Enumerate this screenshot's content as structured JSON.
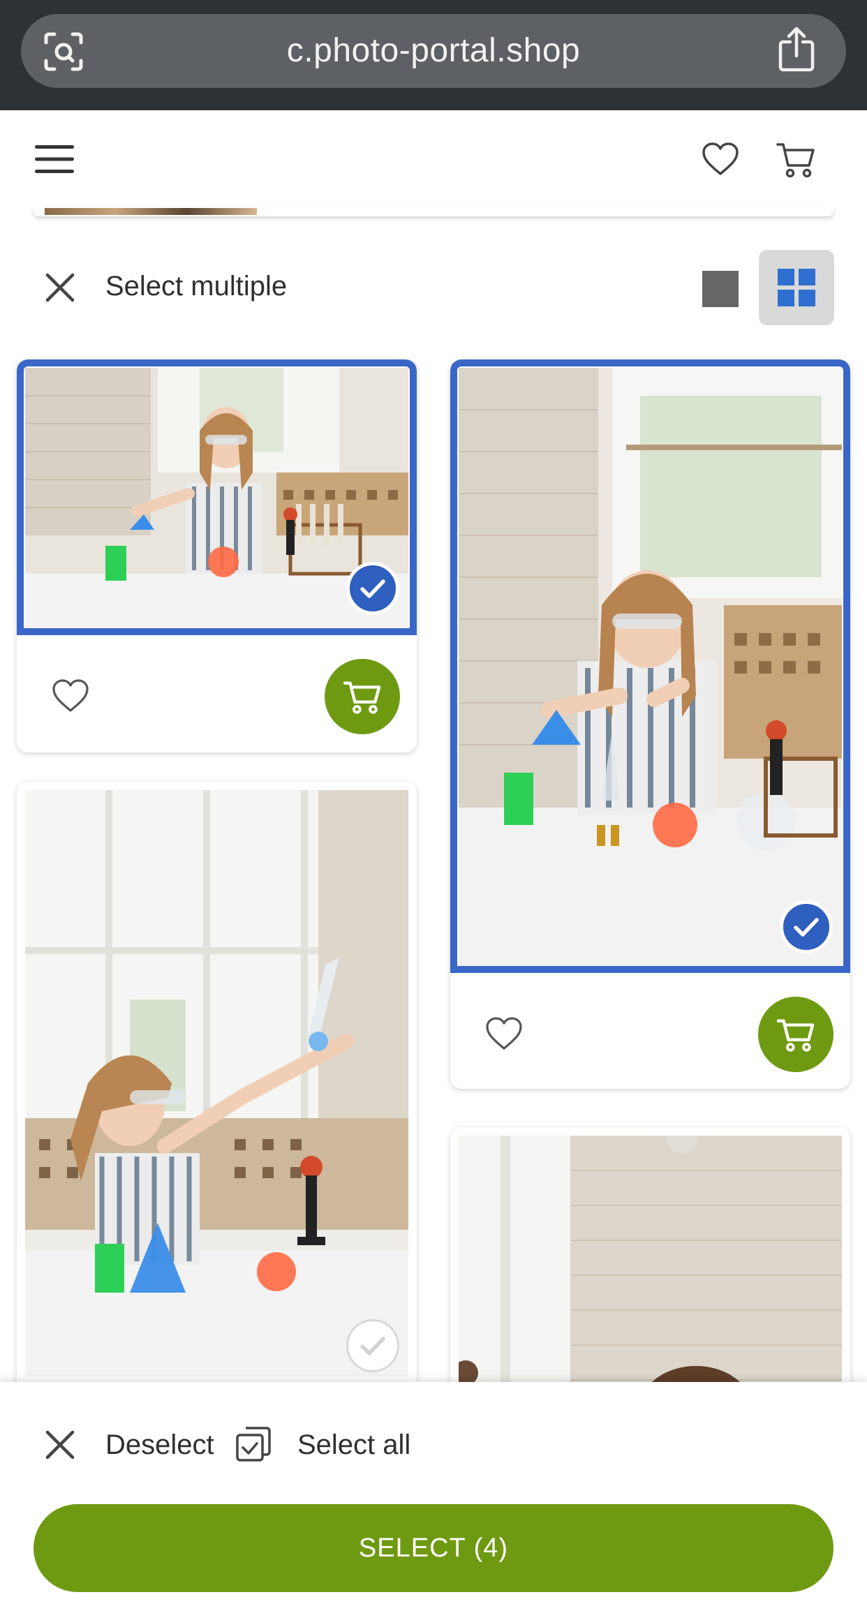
{
  "browser": {
    "url": "c.photo-portal.shop",
    "icons": {
      "left": "lens-icon",
      "right": "share-icon"
    }
  },
  "header": {
    "icons": [
      "menu-icon",
      "heart-icon",
      "cart-icon"
    ]
  },
  "selection_bar": {
    "title": "Select multiple",
    "close_icon": "close-icon",
    "view_modes": [
      "single-view-icon",
      "grid-view-icon"
    ],
    "active_view": "grid"
  },
  "photos": [
    {
      "id": "photo-1",
      "selected": true
    },
    {
      "id": "photo-2",
      "selected": true
    },
    {
      "id": "photo-3",
      "selected": false
    },
    {
      "id": "photo-4",
      "selected": false
    }
  ],
  "bottom": {
    "deselect_label": "Deselect",
    "select_all_label": "Select all",
    "primary_label": "SELECT (4)"
  },
  "colors": {
    "accent_green": "#6e9a12",
    "selection_blue": "#3a67c7",
    "browser_bar": "#2e3135"
  }
}
